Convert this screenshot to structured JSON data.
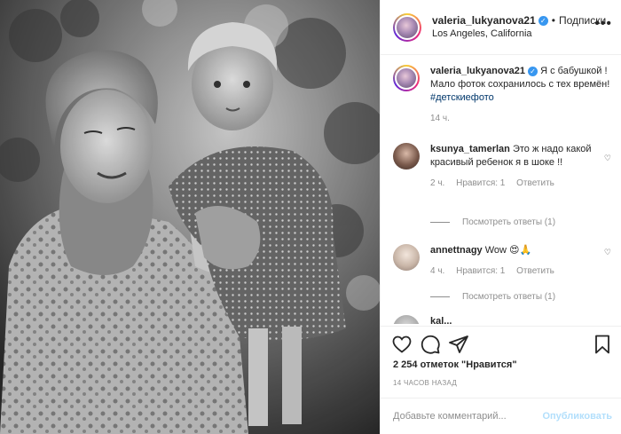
{
  "post": {
    "username": "valeria_lukyanova21",
    "separator": "•",
    "follow_label": "Подписки",
    "location": "Los Angeles, California"
  },
  "caption": {
    "username": "valeria_lukyanova21",
    "text": "Я с бабушкой ! Мало фоток сохранилось с тех времён!",
    "hashtag": "#детскиефото",
    "time": "14 ч."
  },
  "comments": [
    {
      "username": "ksunya_tamerlan",
      "text": "Это ж надо какой красивый ребенок я в шоке !!",
      "time": "2 ч.",
      "likes": "Нравится: 1",
      "reply": "Ответить",
      "view_replies": "Посмотреть ответы (1)"
    },
    {
      "username": "annettnagy",
      "text": "Wow 😍🙏",
      "time": "4 ч.",
      "likes": "Нравится: 1",
      "reply": "Ответить",
      "view_replies": "Посмотреть ответы (1)"
    },
    {
      "username": "kal...",
      "text": ""
    }
  ],
  "likes_count": "2 254 отметок \"Нравится\"",
  "posted_ago": "14 ЧАСОВ НАЗАД",
  "add_comment": {
    "placeholder": "Добавьте комментарий...",
    "publish": "Опубликовать"
  },
  "icons": {
    "verified": "verified-badge-icon",
    "more": "more-options-icon",
    "like": "heart-icon",
    "comment": "comment-icon",
    "share": "send-icon",
    "save": "bookmark-icon",
    "comment_like": "small-heart-icon"
  },
  "colors": {
    "link": "#00376b",
    "secondary_text": "#8e8e8e",
    "verified": "#3897f0",
    "publish_disabled": "#b2dffc"
  }
}
